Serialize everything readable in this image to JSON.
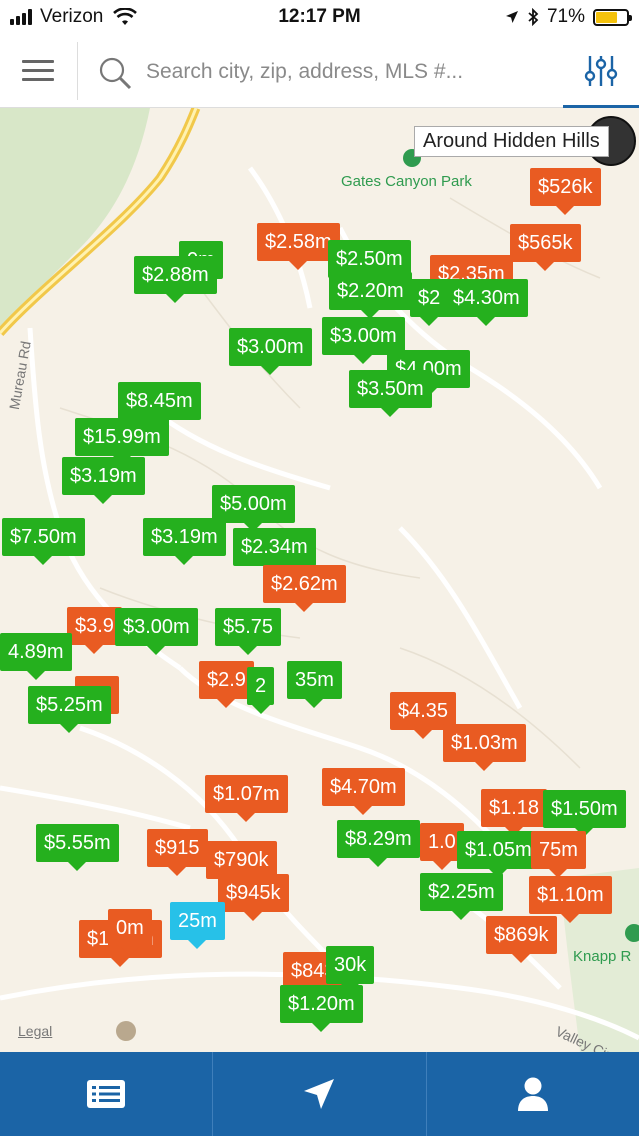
{
  "status_bar": {
    "carrier": "Verizon",
    "time": "12:17 PM",
    "battery": "71%",
    "battery_level": 0.71,
    "icons": [
      "signal-icon",
      "wifi-icon",
      "location-arrow-icon",
      "bluetooth-icon",
      "battery-icon"
    ]
  },
  "search": {
    "placeholder": "Search city, zip, address, MLS #..."
  },
  "header_icons": [
    "menu-icon",
    "search-icon",
    "filter-sliders-icon"
  ],
  "map": {
    "area_label": "Around Hidden Hills",
    "poi": [
      {
        "name": "Gates Canyon Park"
      },
      {
        "name": "Knapp R"
      }
    ],
    "streets": [
      "Mureau Rd",
      "Valley Circ",
      "Legal"
    ],
    "listings": [
      {
        "price": "$526k",
        "color": "orange"
      },
      {
        "price": "$565k",
        "color": "orange"
      },
      {
        "price": "$2.58m",
        "color": "orange"
      },
      {
        "price": "0m",
        "color": "green"
      },
      {
        "price": "$2.88m",
        "color": "green"
      },
      {
        "price": "$2.50m",
        "color": "green"
      },
      {
        "price": "$2.35m",
        "color": "orange"
      },
      {
        "price": "$2.20m",
        "color": "green"
      },
      {
        "price": "$2",
        "color": "green"
      },
      {
        "price": "$4.30m",
        "color": "green"
      },
      {
        "price": "$3.00m",
        "color": "green"
      },
      {
        "price": "$3.00m",
        "color": "green"
      },
      {
        "price": "$4.00m",
        "color": "green"
      },
      {
        "price": "$3.50m",
        "color": "green"
      },
      {
        "price": "$8.45m",
        "color": "green"
      },
      {
        "price": "$15.99m",
        "color": "green"
      },
      {
        "price": "$3.19m",
        "color": "green"
      },
      {
        "price": "$5.00m",
        "color": "green"
      },
      {
        "price": "$7.50m",
        "color": "green"
      },
      {
        "price": "$3.19m",
        "color": "green"
      },
      {
        "price": "$2.34m",
        "color": "green"
      },
      {
        "price": "$2.62m",
        "color": "orange"
      },
      {
        "price": "$3.9",
        "color": "orange"
      },
      {
        "price": "$3.00m",
        "color": "green"
      },
      {
        "price": "$5.75",
        "color": "green"
      },
      {
        "price": "4.89m",
        "color": "green"
      },
      {
        "price": "35m",
        "color": "green"
      },
      {
        "price": "$2.9",
        "color": "orange"
      },
      {
        "price": "2",
        "color": "green"
      },
      {
        "price": "5m",
        "color": "orange"
      },
      {
        "price": "$5.25m",
        "color": "green"
      },
      {
        "price": "$4.35",
        "color": "orange"
      },
      {
        "price": "$1.03m",
        "color": "orange"
      },
      {
        "price": "$1.07m",
        "color": "orange"
      },
      {
        "price": "$4.70m",
        "color": "orange"
      },
      {
        "price": "$1.18",
        "color": "orange"
      },
      {
        "price": "$1.50m",
        "color": "green"
      },
      {
        "price": "$5.55m",
        "color": "green"
      },
      {
        "price": "$8.29m",
        "color": "green"
      },
      {
        "price": "1.0",
        "color": "orange"
      },
      {
        "price": "$1.05m",
        "color": "green"
      },
      {
        "price": "75m",
        "color": "orange"
      },
      {
        "price": "$915",
        "color": "orange"
      },
      {
        "price": "$790k",
        "color": "orange"
      },
      {
        "price": "$945k",
        "color": "orange"
      },
      {
        "price": "$2.25m",
        "color": "green"
      },
      {
        "price": "$1.10m",
        "color": "orange"
      },
      {
        "price": "25m",
        "color": "blue"
      },
      {
        "price": "$1.14m",
        "color": "orange"
      },
      {
        "price": "0m",
        "color": "orange"
      },
      {
        "price": "$869k",
        "color": "orange"
      },
      {
        "price": "$843k",
        "color": "orange"
      },
      {
        "price": "30k",
        "color": "green"
      },
      {
        "price": "$1.20m",
        "color": "green"
      }
    ]
  },
  "tab_bar": {
    "tabs": [
      {
        "name": "list-view-icon"
      },
      {
        "name": "nearby-location-icon"
      },
      {
        "name": "profile-icon"
      }
    ]
  },
  "colors": {
    "sold": "#e95b22",
    "active": "#25b01e",
    "selected": "#27c1e8",
    "accent": "#1b64a6"
  }
}
